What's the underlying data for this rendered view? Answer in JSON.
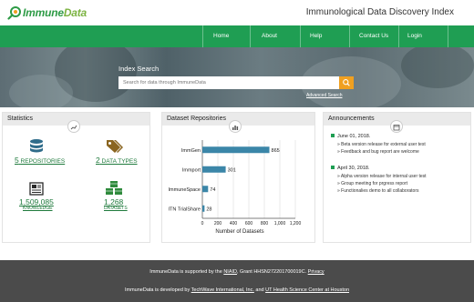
{
  "header": {
    "logo_text_1": "Immune",
    "logo_text_2": "Data",
    "site_title": "Immunological Data Discovery Index"
  },
  "nav": {
    "items": [
      "Home",
      "About",
      "Help",
      "Contact Us",
      "Login"
    ]
  },
  "search": {
    "label": "Index Search",
    "placeholder": "Search for data through ImmuneData",
    "advanced_link": "Advanced Search"
  },
  "statistics": {
    "title": "Statistics",
    "icon": "line-chart-icon",
    "items": [
      {
        "number": "5",
        "label": "REPOSITORIES",
        "icon": "database-icon"
      },
      {
        "number": "2",
        "label": "DATA TYPES",
        "icon": "tags-icon"
      },
      {
        "number": "1,509,085",
        "label": "KNOWLEDGE",
        "icon": "newspaper-icon"
      },
      {
        "number": "1,268",
        "label": "DATASETS",
        "icon": "cubes-icon"
      }
    ]
  },
  "repositories": {
    "title": "Dataset Repositories",
    "icon": "bar-chart-icon"
  },
  "chart_data": {
    "type": "bar",
    "orientation": "horizontal",
    "categories": [
      "ImmGen",
      "Immport",
      "ImmuneSpace",
      "ITN TrialShare"
    ],
    "values": [
      865,
      301,
      74,
      28
    ],
    "xlabel": "Number of Datasets",
    "xlim": [
      0,
      1200
    ],
    "xticks": [
      "0",
      "200",
      "400",
      "600",
      "800",
      "1,000",
      "1,200"
    ],
    "grid": true,
    "bar_color": "#3b86a8"
  },
  "announcements": {
    "title": "Announcements",
    "icon": "calendar-icon",
    "entries": [
      {
        "date": "June 01, 2018.",
        "lines": [
          "» Beta version release for external user test",
          "» Feedback and bug report are welcome"
        ]
      },
      {
        "date": "April 30, 2018.",
        "lines": [
          "» Alpha version release for internal user test",
          "» Group meeting for prgress report",
          "» Functionalies demo to all collaborators"
        ]
      }
    ]
  },
  "footer": {
    "line1_pre": "ImmuneData is supported by the ",
    "line1_link1": "NIAID",
    "line1_mid": ", Grant HHSN272201700019C. ",
    "line1_link2": "Privacy",
    "line2_pre": "ImmuneData is developed by ",
    "line2_link1": "TechWave International, Inc.",
    "line2_mid": " and ",
    "line2_link2": "UT Health Science Center at Houston"
  },
  "colors": {
    "brand_green": "#1f9e53",
    "accent_orange": "#f0a020",
    "footer_gray": "#4b4b4b"
  }
}
